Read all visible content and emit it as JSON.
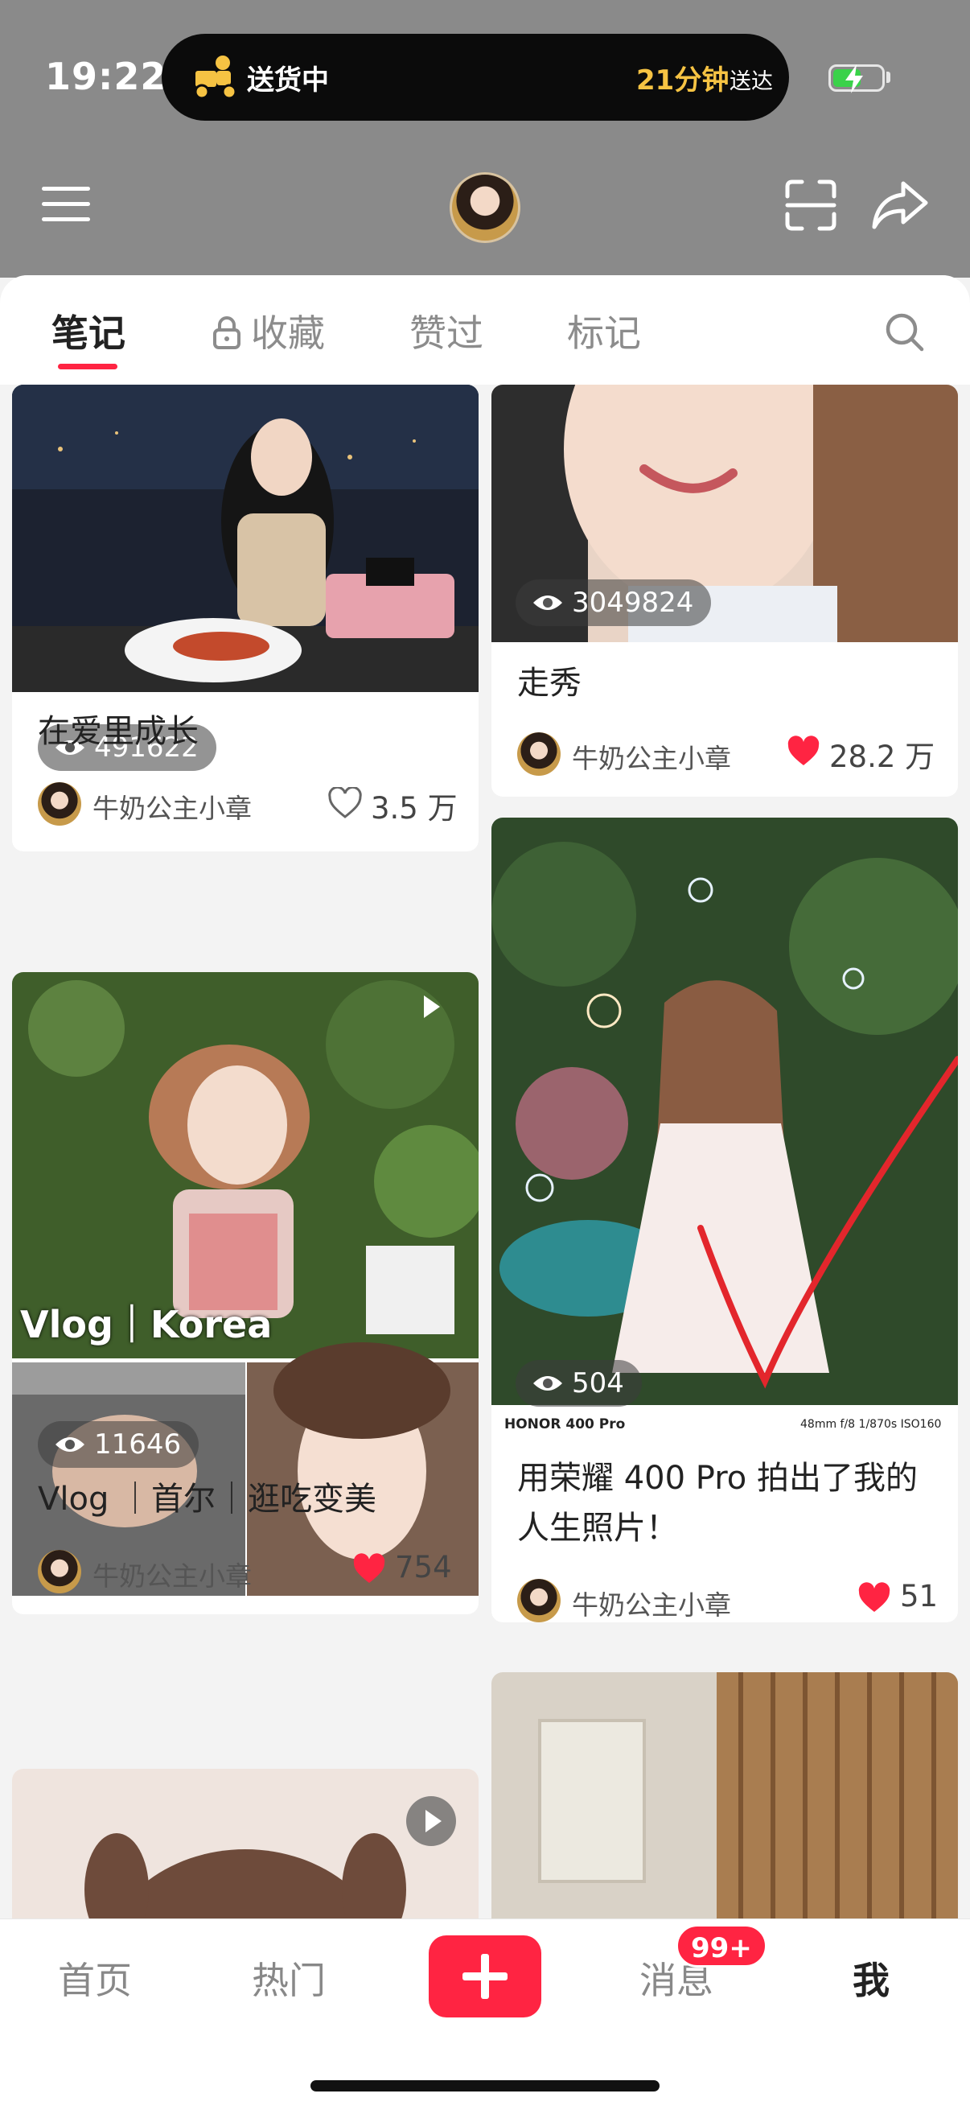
{
  "status_bar": {
    "time": "19:22",
    "delivery_status": "送货中",
    "eta_number": "21分钟",
    "eta_label": "送达"
  },
  "tabs": {
    "notes": "笔记",
    "favorites": "收藏",
    "liked": "赞过",
    "tagged": "标记"
  },
  "left_column": [
    {
      "views": "491622",
      "title": "在爱里成长",
      "author": "牛奶公主小章",
      "likes": "3.5 万",
      "liked": false
    },
    {
      "views": "11646",
      "title": "Vlog ｜首尔｜逛吃变美",
      "author": "牛奶公主小章",
      "likes": "754",
      "liked": true,
      "overlay_text": "Vlog｜Korea"
    }
  ],
  "right_column": [
    {
      "views": "3049824",
      "title": "走秀",
      "author": "牛奶公主小章",
      "likes": "28.2 万",
      "liked": true
    },
    {
      "views": "504",
      "title_line1": "用荣耀 400 Pro 拍出了我的",
      "title_line2": "人生照片！",
      "author": "牛奶公主小章",
      "likes": "51",
      "liked": true,
      "watermark_left": "HONOR 400 Pro",
      "watermark_right": "48mm  f/8  1/870s  ISO160"
    }
  ],
  "bottom_nav": {
    "home": "首页",
    "hot": "热门",
    "messages": "消息",
    "messages_badge": "99+",
    "me": "我"
  },
  "colors": {
    "accent": "#ff2442",
    "eta": "#f6c343",
    "header_bg": "#8a8a8a"
  }
}
